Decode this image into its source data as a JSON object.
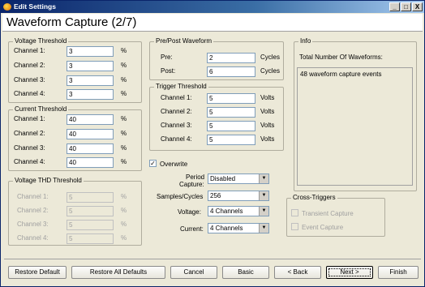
{
  "window": {
    "title": "Edit Settings",
    "page_title": "Waveform Capture (2/7)",
    "controls": {
      "minimize": "_",
      "maximize": "□",
      "close": "X"
    }
  },
  "voltage_threshold": {
    "legend": "Voltage Threshold",
    "unit": "%",
    "channels": [
      {
        "label": "Channel 1:",
        "value": "3"
      },
      {
        "label": "Channel 2:",
        "value": "3"
      },
      {
        "label": "Channel 3:",
        "value": "3"
      },
      {
        "label": "Channel 4:",
        "value": "3"
      }
    ]
  },
  "current_threshold": {
    "legend": "Current Threshold",
    "unit": "%",
    "channels": [
      {
        "label": "Channel 1:",
        "value": "40"
      },
      {
        "label": "Channel 2:",
        "value": "40"
      },
      {
        "label": "Channel 3:",
        "value": "40"
      },
      {
        "label": "Channel 4:",
        "value": "40"
      }
    ]
  },
  "voltage_thd_threshold": {
    "legend": "Voltage THD Threshold",
    "unit": "%",
    "channels": [
      {
        "label": "Channel 1:",
        "value": "5"
      },
      {
        "label": "Channel 2:",
        "value": "5"
      },
      {
        "label": "Channel 3:",
        "value": "5"
      },
      {
        "label": "Channel 4:",
        "value": "5"
      }
    ]
  },
  "pre_post_waveform": {
    "legend": "Pre/Post Waveform",
    "pre_label": "Pre:",
    "pre_value": "2",
    "pre_unit": "Cycles",
    "post_label": "Post:",
    "post_value": "6",
    "post_unit": "Cycles"
  },
  "trigger_threshold": {
    "legend": "Trigger Threshold",
    "unit": "Volts",
    "channels": [
      {
        "label": "Channel 1:",
        "value": "5"
      },
      {
        "label": "Channel 2:",
        "value": "5"
      },
      {
        "label": "Channel 3:",
        "value": "5"
      },
      {
        "label": "Channel 4:",
        "value": "5"
      }
    ]
  },
  "overwrite": {
    "label": "Overwrite",
    "checked": true,
    "mark": "✓"
  },
  "settings": {
    "period_capture_label": "Period\nCapture:",
    "period_capture_line1": "Period",
    "period_capture_line2": "Capture:",
    "period_capture_value": "Disabled",
    "samples_label": "Samples/Cycles",
    "samples_value": "256",
    "voltage_label": "Voltage:",
    "voltage_value": "4 Channels",
    "current_label": "Current:",
    "current_value": "4 Channels"
  },
  "info": {
    "legend": "Info",
    "total_label": "Total Number Of Waveforms:",
    "events_text": "48 waveform capture events"
  },
  "cross_triggers": {
    "legend": "Cross-Triggers",
    "transient_label": "Transient Capture",
    "event_label": "Event Capture"
  },
  "buttons": {
    "restore_default": "Restore Default",
    "restore_all_defaults": "Restore All Defaults",
    "cancel": "Cancel",
    "basic": "Basic",
    "back": "< Back",
    "next": "Next >",
    "finish": "Finish"
  }
}
